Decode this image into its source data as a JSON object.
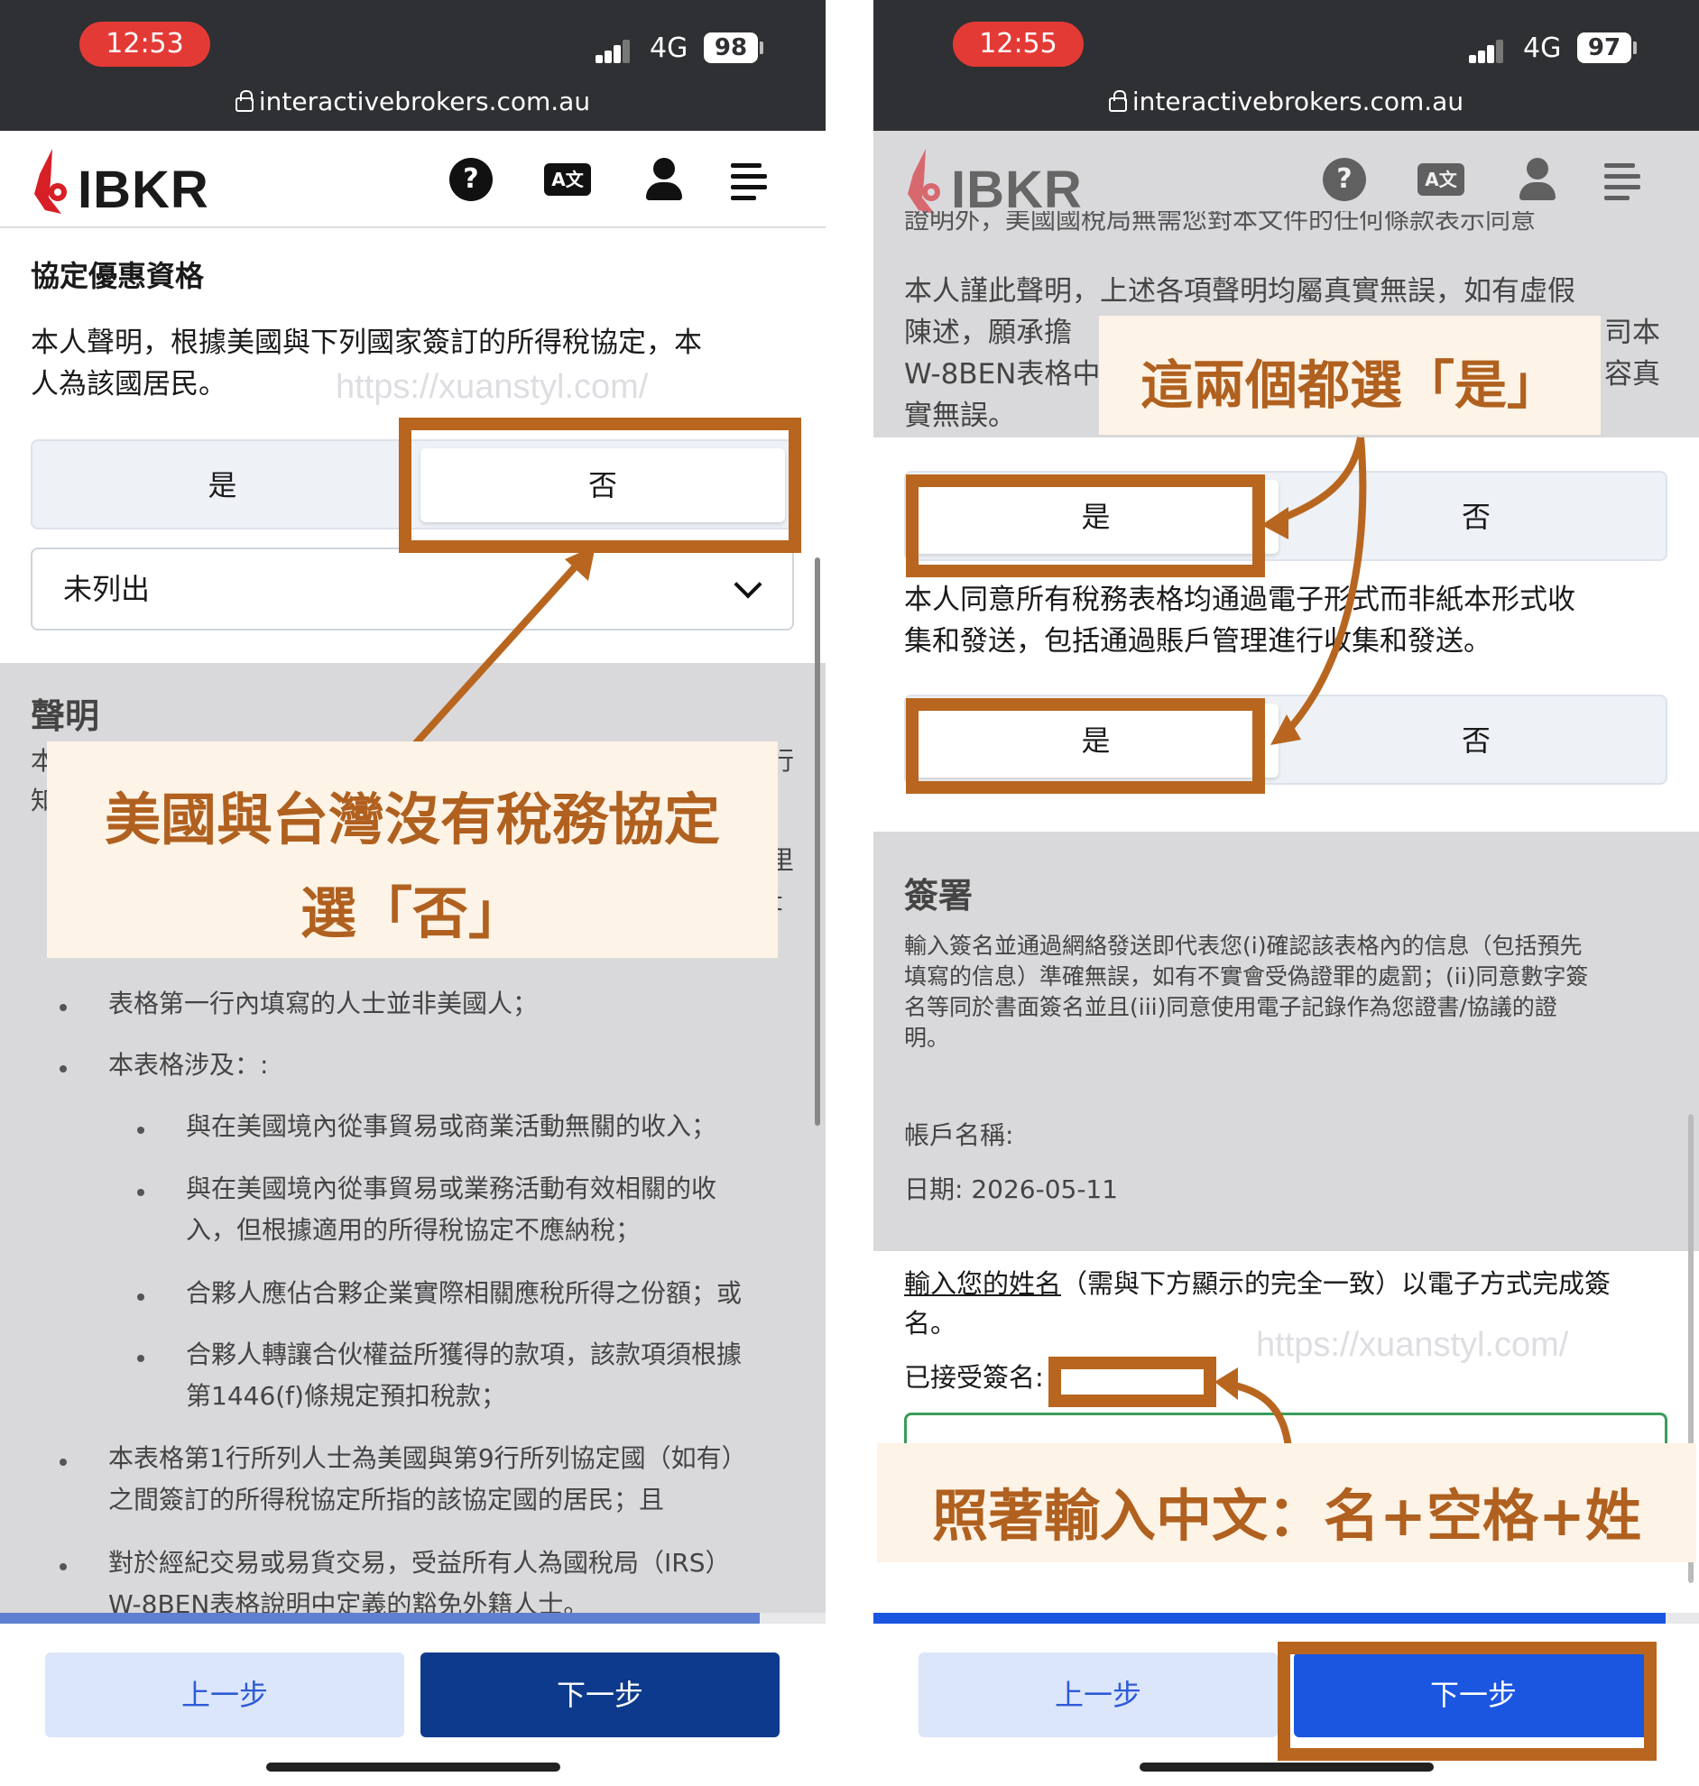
{
  "left": {
    "status": {
      "time": "12:53",
      "network": "4G",
      "battery": "98",
      "url": "interactivebrokers.com.au"
    },
    "header": {
      "logo_text": "IBKR",
      "help_icon": "?",
      "translate_icon": "A文"
    },
    "treaty": {
      "title": "協定優惠資格",
      "line1": "本人聲明，根據美國與下列國家簽訂的所得稅協定，本",
      "line2": "人為該國居民。",
      "yes": "是",
      "no": "否",
      "country": "未列出"
    },
    "declaration": {
      "title": "聲明",
      "frag_left1": "本",
      "frag_left2": "知",
      "frag_right1": "行",
      "frag_right2": "里",
      "frag_right3": "t",
      "bullets": [
        "表格第一行內填寫的人士並非美國人；",
        "本表格涉及：:",
        "與在美國境內從事貿易或商業活動無關的收入；",
        "與在美國境內從事貿易或業務活動有效相關的收",
        "入，但根據適用的所得稅協定不應納稅；",
        "合夥人應佔合夥企業實際相關應稅所得之份額；或",
        "合夥人轉讓合伙權益所獲得的款項，該款項須根據",
        "第1446(f)條規定預扣稅款；",
        "本表格第1行所列人士為美國與第9行所列協定國（如有）",
        "之間簽訂的所得稅協定所指的該協定國的居民；且",
        "對於經紀交易或易貨交易，受益所有人為國稅局（IRS）",
        "W-8BEN表格說明中定義的豁免外籍人士。"
      ]
    },
    "progress": 0.92,
    "buttons": {
      "prev": "上一步",
      "next": "下一步"
    },
    "watermark": "https://xuanstyl.com/",
    "annotation": {
      "line1": "美國與台灣沒有稅務協定",
      "line2": "選「否」"
    }
  },
  "right": {
    "status": {
      "time": "12:55",
      "network": "4G",
      "battery": "97",
      "url": "interactivebrokers.com.au"
    },
    "header": {
      "logo_text": "IBKR",
      "help_icon": "?",
      "translate_icon": "A文"
    },
    "top_fragment": "證明外，美國國稅局無需您對本文件的任何條款表示同意",
    "certify": {
      "line1": "本人謹此聲明，上述各項聲明均屬真實無誤，如有虛假",
      "line2a": "陳述，願承擔",
      "line2b": "司本",
      "line3a": "W-8BEN表格中",
      "line3b": "容真",
      "line4": "實無誤。"
    },
    "q1": {
      "yes": "是",
      "no": "否"
    },
    "consent": {
      "line1": "本人同意所有稅務表格均通過電子形式而非紙本形式收",
      "line2": "集和發送，包括通過賬戶管理進行收集和發送。"
    },
    "q2": {
      "yes": "是",
      "no": "否"
    },
    "signature": {
      "title": "簽署",
      "desc1": "輸入簽名並通過網絡發送即代表您(i)確認該表格內的信息（包括預先",
      "desc2": "填寫的信息）準確無誤，如有不實會受偽證罪的處罰；(ii)同意數字簽",
      "desc3": "名等同於書面簽名並且(iii)同意使用電子記錄作為您證書/協議的證",
      "desc4": "明。",
      "account_label": "帳戶名稱:",
      "date_label": "日期: 2026-05-11",
      "instruction_link": "輸入您的姓名",
      "instruction_rest": "（需與下方顯示的完全一致）以電子方式完成簽",
      "instruction_line2": "名。",
      "accepted_label": "已接受簽名:"
    },
    "progress": 0.96,
    "buttons": {
      "prev": "上一步",
      "next": "下一步"
    },
    "watermark": "https://xuanstyl.com/",
    "annotation_top": "這兩個都選「是」",
    "annotation_bottom": "照著輸入中文：名+空格+姓"
  },
  "colors": {
    "status_bar": "#2f3033",
    "time_pill": "#e43a36",
    "next_left": "#0d3a8c",
    "next_right": "#1a56e0",
    "progress_left": "#5f7fd2",
    "progress_right": "#1a56e0",
    "annotation": "#b8661f",
    "logo_red": "#d71f26"
  },
  "icons": [
    "lock-icon",
    "help-icon",
    "translate-icon",
    "user-icon",
    "menu-icon",
    "chevron-down-icon",
    "arrow-icon"
  ]
}
